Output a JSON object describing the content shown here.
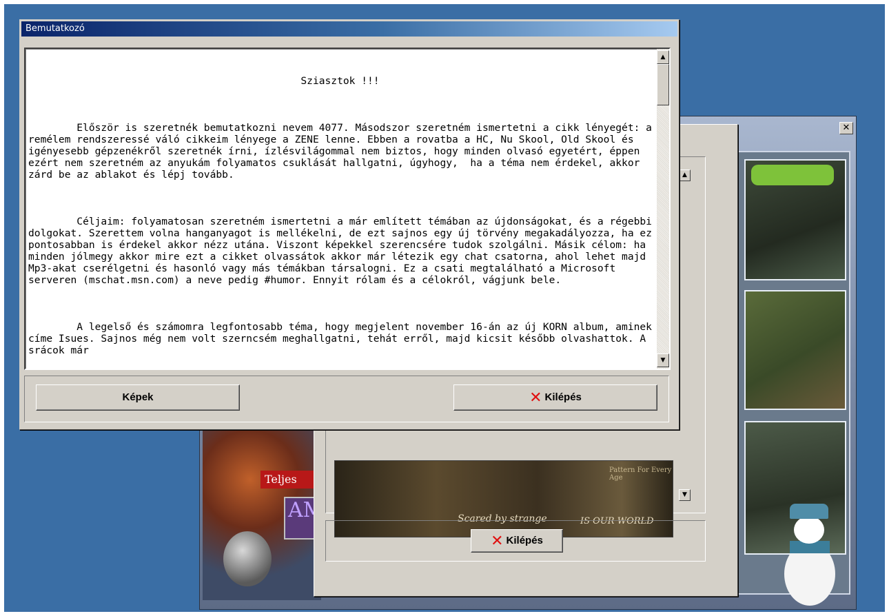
{
  "desktop": {
    "background_color": "#3a6ea5"
  },
  "back_window": {
    "close_glyph": "✕",
    "left_label_red": "Teljes",
    "left_label_purple": "AM",
    "image_text_1": "Scared by strange",
    "image_text_2": "IS OUR WORLD",
    "image_text_3": "Pattern For Every Age"
  },
  "middle_window": {
    "exit_button_label": "Kilépés",
    "exit_icon": "red-x-icon"
  },
  "dialog": {
    "title": "Bemutatkozó",
    "heading": "Sziasztok !!!",
    "paragraphs": [
      "Először is szeretnék bemutatkozni nevem 4077. Másodszor szeretném ismertetni a cikk lényegét: a remélem rendszeressé váló cikkeim lényege a ZENE lenne. Ebben a rovatba a HC, Nu Skool, Old Skool és igényesebb gépzenékről szeretnék írni, ízlésvilágommal nem biztos, hogy minden olvasó egyetért, éppen ezért nem szeretném az anyukám folyamatos csuklását hallgatni, úgyhogy,  ha a téma nem érdekel, akkor zárd be az ablakot és lépj tovább.",
      "Céljaim: folyamatosan szeretném ismertetni a már említett témában az újdonságokat, és a régebbi dolgokat. Szerettem volna hanganyagot is mellékelni, de ezt sajnos egy új törvény megakadályozza, ha ez pontosabban is érdekel akkor nézz utána. Viszont képekkel szerencsére tudok szolgálni. Másik célom: ha minden jólmegy akkor mire ezt a cikket olvassátok akkor már létezik egy chat csatorna, ahol lehet majd Mp3-akat cserélgetni és hasonló vagy más témákban társalogni. Ez a csati megtalálható a Microsoft serveren (mschat.msn.com) a neve pedig #humor. Ennyit rólam és a célokról, vágjunk bele.",
      "A legelső és számomra legfontosabb téma, hogy megjelent november 16-án az új KORN album, aminek címe Isues. Sajnos még nem volt szerncsém meghallgatni, tehát erről, majd kicsit később olvashattok. A srácok már"
    ],
    "scroll_up_glyph": "▲",
    "scroll_down_glyph": "▼",
    "buttons": {
      "pictures_label": "Képek",
      "exit_label": "Kilépés",
      "exit_icon": "red-x-icon",
      "exit_icon_color": "#e01010"
    }
  }
}
